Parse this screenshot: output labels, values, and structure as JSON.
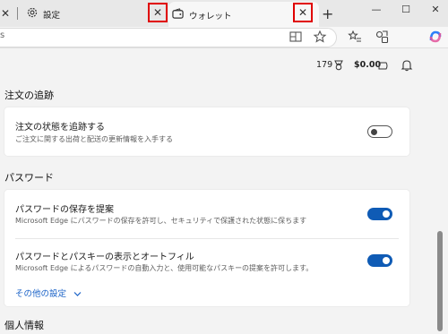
{
  "tabs": {
    "settings_label": "設定",
    "wallet_label": "ウォレット",
    "close_symbol": "✕",
    "new_tab_symbol": "+"
  },
  "window": {
    "minimize": "—",
    "maximize": "☐",
    "close": "✕"
  },
  "address": {
    "partial_text": "s"
  },
  "wallet_bar": {
    "points": "179",
    "balance": "$0.00"
  },
  "sections": {
    "order_tracking": {
      "title": "注文の追跡",
      "row_title": "注文の状態を追跡する",
      "row_desc": "ご注文に関する出荷と配送の更新情報を入手する",
      "toggle": false
    },
    "passwords": {
      "title": "パスワード",
      "save_title": "パスワードの保存を提案",
      "save_desc": "Microsoft Edge にパスワードの保存を許可し、セキュリティで保護された状態に保ちます",
      "save_toggle": true,
      "autofill_title": "パスワードとパスキーの表示とオートフィル",
      "autofill_desc": "Microsoft Edge によるパスワードの自動入力と、使用可能なパスキーの提案を許可します。",
      "autofill_toggle": true,
      "more_settings": "その他の設定"
    },
    "personal_info": {
      "title": "個人情報"
    }
  },
  "colors": {
    "accent": "#0f5bb5",
    "highlight": "#e00000"
  }
}
